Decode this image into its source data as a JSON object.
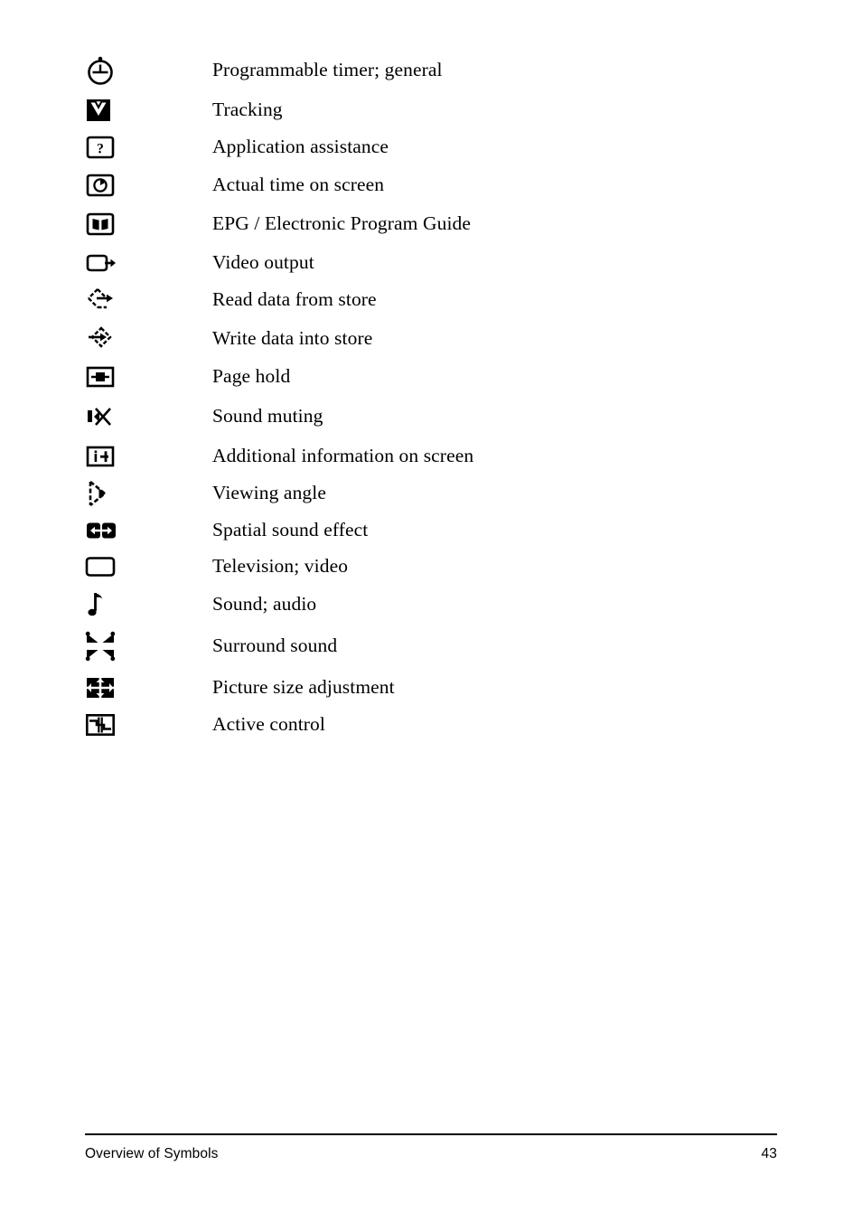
{
  "page": {
    "footer": {
      "section_title": "Overview of Symbols",
      "page_number": "43"
    }
  },
  "symbols": [
    {
      "icon": "programmable-timer-icon",
      "label": "Programmable timer; general"
    },
    {
      "icon": "tracking-icon",
      "label": "Tracking"
    },
    {
      "icon": "application-assistance-icon",
      "label": "Application assistance"
    },
    {
      "icon": "actual-time-on-screen-icon",
      "label": "Actual time on screen"
    },
    {
      "icon": "epg-guide-icon",
      "label": "EPG / Electronic Program Guide"
    },
    {
      "icon": "video-output-icon",
      "label": "Video output"
    },
    {
      "icon": "read-data-from-store-icon",
      "label": "Read data from store"
    },
    {
      "icon": "write-data-into-store-icon",
      "label": "Write data into store"
    },
    {
      "icon": "page-hold-icon",
      "label": "Page hold"
    },
    {
      "icon": "sound-muting-icon",
      "label": "Sound muting"
    },
    {
      "icon": "additional-information-icon",
      "label": "Additional information on screen"
    },
    {
      "icon": "viewing-angle-icon",
      "label": "Viewing angle"
    },
    {
      "icon": "spatial-sound-effect-icon",
      "label": "Spatial sound effect"
    },
    {
      "icon": "television-video-icon",
      "label": "Television; video"
    },
    {
      "icon": "sound-audio-icon",
      "label": "Sound; audio"
    },
    {
      "icon": "surround-sound-icon",
      "label": "Surround sound"
    },
    {
      "icon": "picture-size-adjustment-icon",
      "label": "Picture size adjustment"
    },
    {
      "icon": "active-control-icon",
      "label": "Active control"
    }
  ]
}
